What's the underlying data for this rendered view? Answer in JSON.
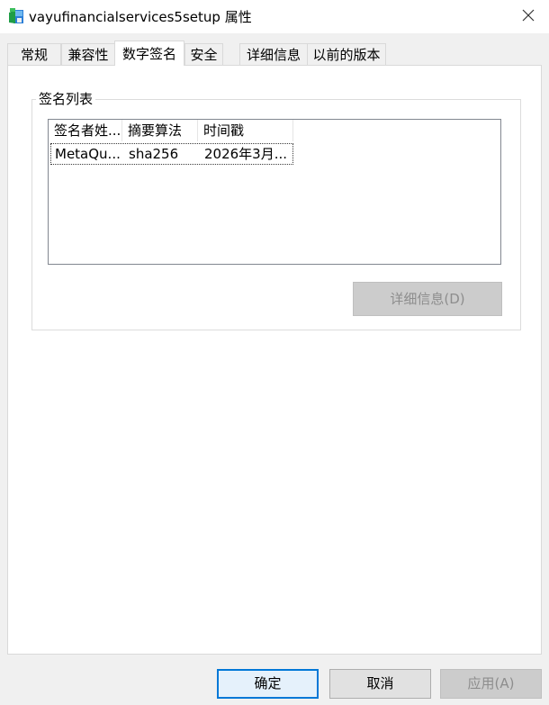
{
  "window": {
    "title": "vayufinancialservices5setup 属性",
    "icon": "installer-app-icon",
    "close_icon": "close-icon"
  },
  "tabs": [
    {
      "label": "常规",
      "active": false
    },
    {
      "label": "兼容性",
      "active": false
    },
    {
      "label": "数字签名",
      "active": true
    },
    {
      "label": "安全",
      "active": false
    },
    {
      "label": "详细信息",
      "active": false
    },
    {
      "label": "以前的版本",
      "active": false
    }
  ],
  "signature_list": {
    "group_label": "签名列表",
    "columns": [
      "签名者姓...",
      "摘要算法",
      "时间戳"
    ],
    "rows": [
      [
        "MetaQu...",
        "sha256",
        "2026年3月..."
      ]
    ],
    "details_button": "详细信息(D)"
  },
  "buttons": {
    "ok": "确定",
    "cancel": "取消",
    "apply": "应用(A)"
  },
  "colors": {
    "accent": "#0078d7",
    "disabled_text": "#8d8d8d"
  }
}
